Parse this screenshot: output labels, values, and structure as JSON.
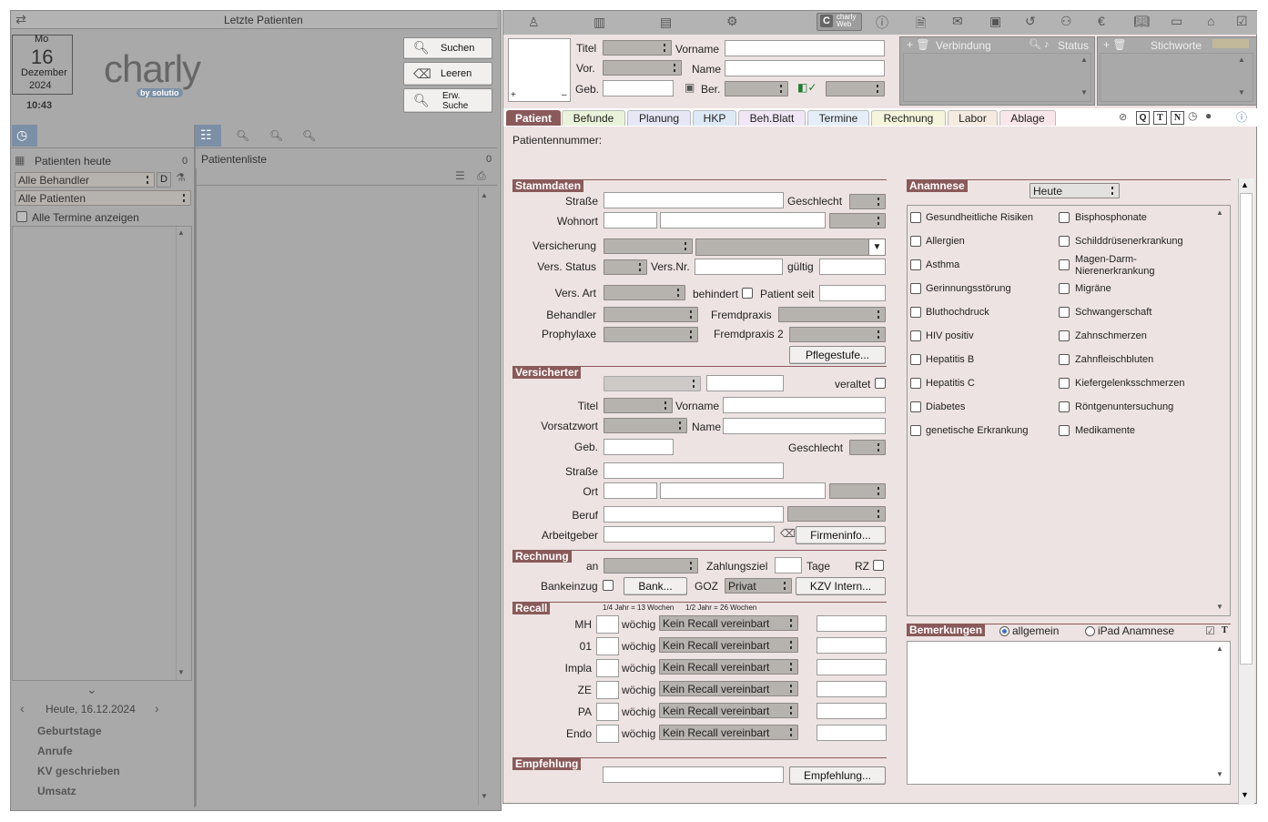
{
  "left": {
    "title": "Letzte Patienten",
    "date": {
      "weekday": "Mo",
      "day": "16",
      "month": "Dezember",
      "year": "2024",
      "time": "10:43"
    },
    "logo": {
      "name": "charly",
      "sub": "by solutio"
    },
    "buttons": {
      "suchen": "Suchen",
      "leeren": "Leeren",
      "erw1": "Erw.",
      "erw2": "Suche"
    },
    "patients_today": "Patienten heute",
    "patients_today_count": "0",
    "patient_list": "Patientenliste",
    "patient_list_count": "0",
    "filter_behandler": "Alle Behandler",
    "filter_d": "D",
    "filter_patienten": "Alle Patienten",
    "show_all": "Alle Termine anzeigen",
    "today": "Heute, 16.12.2024",
    "links": [
      "Geburtstage",
      "Anrufe",
      "KV geschrieben",
      "Umsatz"
    ]
  },
  "top": {
    "titel": "Titel",
    "vor": "Vor.",
    "geb": "Geb.",
    "vorname": "Vorname",
    "name": "Name",
    "ber": "Ber.",
    "plus": "+",
    "minus": "–",
    "verbindung": "Verbindung",
    "status": "Status",
    "stichworte": "Stichworte",
    "web": "charly Web"
  },
  "tabs": [
    "Patient",
    "Befunde",
    "Planung",
    "HKP",
    "Beh.Blatt",
    "Termine",
    "Rechnung",
    "Labor",
    "Ablage"
  ],
  "tab_toolbar": [
    "Q",
    "T",
    "N"
  ],
  "patientnr": "Patientennummer:",
  "stamm": {
    "title": "Stammdaten",
    "strasse": "Straße",
    "geschlecht": "Geschlecht",
    "wohnort": "Wohnort",
    "versicherung": "Versicherung",
    "vstatus": "Vers. Status",
    "vnr": "Vers.Nr.",
    "gueltig": "gültig",
    "vart": "Vers. Art",
    "behindert": "behindert",
    "patientseit": "Patient seit",
    "behandler": "Behandler",
    "fremd": "Fremdpraxis",
    "prophy": "Prophylaxe",
    "fremd2": "Fremdpraxis 2",
    "pflege": "Pflegestufe..."
  },
  "vers": {
    "title": "Versicherter",
    "veraltet": "veraltet",
    "titel": "Titel",
    "vorname": "Vorname",
    "vorsatz": "Vorsatzwort",
    "name": "Name",
    "geb": "Geb.",
    "geschlecht": "Geschlecht",
    "strasse": "Straße",
    "ort": "Ort",
    "beruf": "Beruf",
    "arbeitgeber": "Arbeitgeber",
    "firmen": "Firmeninfo..."
  },
  "rech": {
    "title": "Rechnung",
    "an": "an",
    "ziel": "Zahlungsziel",
    "tage": "Tage",
    "rz": "RZ",
    "bank_einzug": "Bankeinzug",
    "bank": "Bank...",
    "goz": "GOZ",
    "goz_val": "Privat",
    "kzv": "KZV Intern..."
  },
  "recall": {
    "title": "Recall",
    "hint1": "1/4 Jahr = 13 Wochen",
    "hint2": "1/2 Jahr = 26 Wochen",
    "woechig": "wöchig",
    "rows": [
      {
        "label": "MH",
        "value": "Kein Recall vereinbart"
      },
      {
        "label": "01",
        "value": "Kein Recall vereinbart"
      },
      {
        "label": "Impla",
        "value": "Kein Recall vereinbart"
      },
      {
        "label": "ZE",
        "value": "Kein Recall vereinbart"
      },
      {
        "label": "PA",
        "value": "Kein Recall vereinbart"
      },
      {
        "label": "Endo",
        "value": "Kein Recall vereinbart"
      }
    ]
  },
  "empf": {
    "title": "Empfehlung",
    "btn": "Empfehlung..."
  },
  "anamnese": {
    "title": "Anamnese",
    "select": "Heute",
    "left": [
      "Gesundheitliche Risiken",
      "Allergien",
      "Asthma",
      "Gerinnungsstörung",
      "Bluthochdruck",
      "HIV positiv",
      "Hepatitis B",
      "Hepatitis C",
      "Diabetes",
      "genetische Erkrankung"
    ],
    "right": [
      "Bisphosphonate",
      "Schilddrüsenerkrankung",
      "Magen-Darm-",
      "Nierenerkrankung",
      "Migräne",
      "Schwangerschaft",
      "Zahnschmerzen",
      "Zahnfleischbluten",
      "Kiefergelenksschmerzen",
      "Röntgenuntersuchung",
      "Medikamente"
    ]
  },
  "bemerk": {
    "title": "Bemerkungen",
    "allgemein": "allgemein",
    "ipad": "iPad Anamnese",
    "t": "T"
  }
}
